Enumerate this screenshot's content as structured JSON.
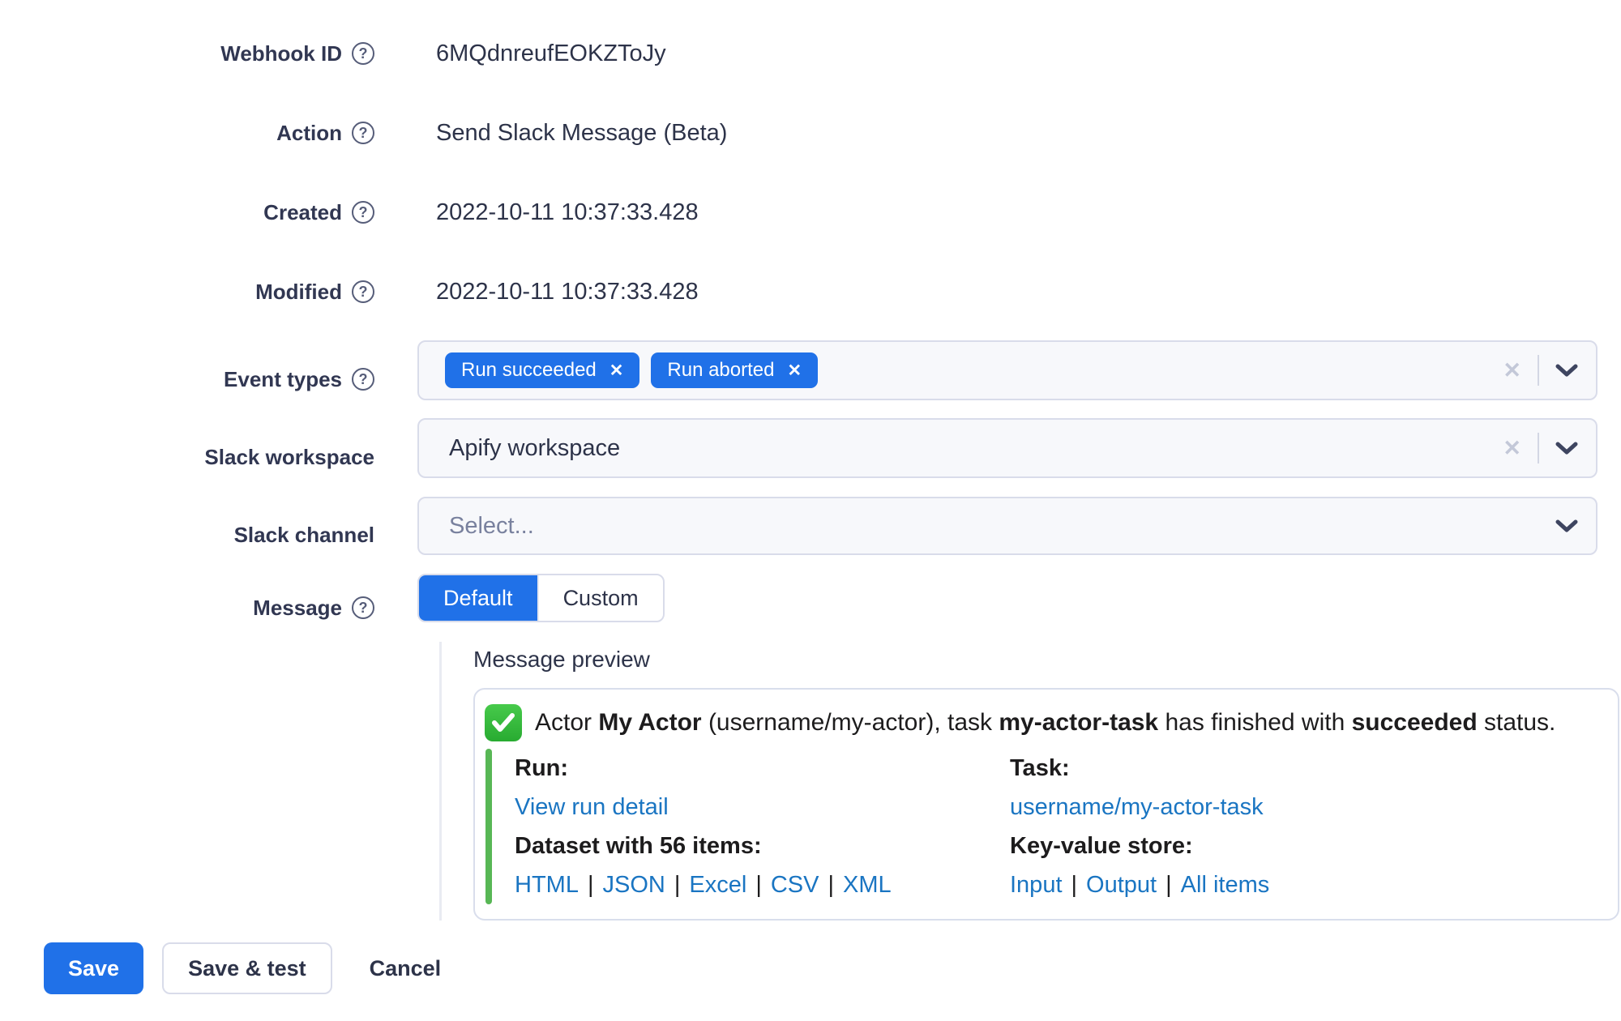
{
  "colors": {
    "accent_blue": "#2071e8",
    "text_primary": "#2d3349",
    "slack_text": "#1d1c1d",
    "link_blue": "#1a75c2",
    "attachment_bar_green": "#58b755",
    "emoji_green": "#34b53a",
    "input_background": "#f7f8fb",
    "input_border": "#d9dcea"
  },
  "glyphs": {
    "help": "?",
    "remove": "✕",
    "clear": "✕"
  },
  "form": {
    "webhook_id": {
      "label": "Webhook ID",
      "value": "6MQdnreufEOKZToJy"
    },
    "action": {
      "label": "Action",
      "value": "Send Slack Message (Beta)"
    },
    "created": {
      "label": "Created",
      "value": "2022-10-11 10:37:33.428"
    },
    "modified": {
      "label": "Modified",
      "value": "2022-10-11 10:37:33.428"
    },
    "event_types": {
      "label": "Event types",
      "tags": [
        {
          "text": "Run succeeded"
        },
        {
          "text": "Run aborted"
        }
      ]
    },
    "slack_workspace": {
      "label": "Slack workspace",
      "value": "Apify workspace"
    },
    "slack_channel": {
      "label": "Slack channel",
      "placeholder": "Select..."
    },
    "message": {
      "label": "Message",
      "options": [
        {
          "label": "Default"
        },
        {
          "label": "Custom"
        }
      ],
      "selected": "Default"
    }
  },
  "preview": {
    "title": "Message preview",
    "line": {
      "t1": "Actor ",
      "b1": "My Actor",
      "t2": " (username/my-actor), task ",
      "b2": "my-actor-task",
      "t3": " has finished with ",
      "b3": "succeeded",
      "t4": " status."
    },
    "run_label": "Run:",
    "run_link": "View run detail",
    "dataset_label": "Dataset with 56 items:",
    "dataset_links": [
      "HTML",
      "JSON",
      "Excel",
      "CSV",
      "XML"
    ],
    "task_label": "Task:",
    "task_link": "username/my-actor-task",
    "kv_label": "Key-value store:",
    "kv_links": [
      "Input",
      "Output",
      "All items"
    ],
    "separator": "|"
  },
  "actions": {
    "save": "Save",
    "save_and_test": "Save & test",
    "cancel": "Cancel"
  }
}
